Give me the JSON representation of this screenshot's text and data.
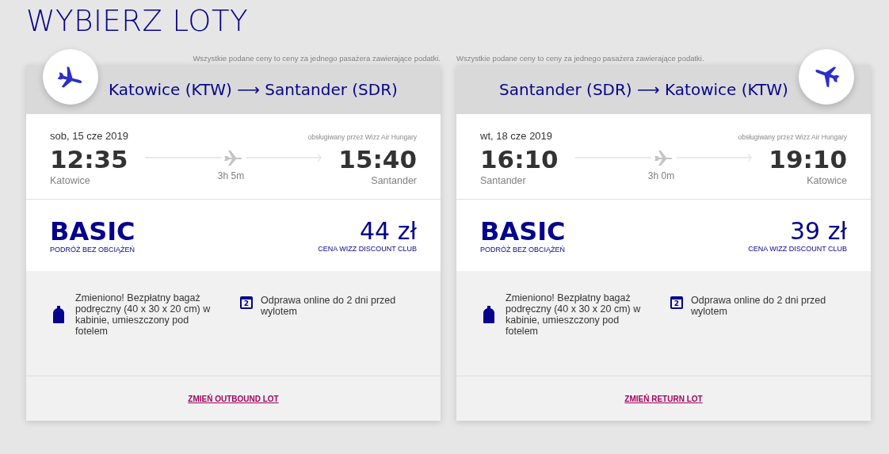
{
  "title": "WYBIERZ LOTY",
  "flights": [
    {
      "kind": "outbound",
      "note": "Wszystkie podane ceny to ceny za jednego pasażera zawierające podatki.",
      "route": "Katowice (KTW) ⟶ Santander (SDR)",
      "date": "sob, 15 cze 2019",
      "operator": "obsługiwany przez Wizz Air Hungary",
      "depart_time": "12:35",
      "depart_city": "Katowice",
      "duration": "3h 5m",
      "arrive_time": "15:40",
      "arrive_city": "Santander",
      "fare": "BASIC",
      "fare_sub": "PODRÓŻ BEZ OBCIĄŻEŃ",
      "price": "44 zł",
      "price_sub": "CENA WIZZ DISCOUNT CLUB",
      "features": [
        {
          "kind": "bag",
          "text": "Zmieniono! Bezpłatny bagaż podręczny (40 x 30 x 20 cm) w kabinie, umieszczony pod fotelem"
        },
        {
          "kind": "calendar",
          "day": "2",
          "text": "Odprawa online do 2 dni przed wylotem"
        }
      ],
      "change_link": "ZMIEŃ OUTBOUND LOT"
    },
    {
      "kind": "return",
      "note": "Wszystkie podane ceny to ceny za jednego pasażera zawierające podatki.",
      "route": "Santander (SDR) ⟶ Katowice (KTW)",
      "date": "wt, 18 cze 2019",
      "operator": "obsługiwany przez Wizz Air Hungary",
      "depart_time": "16:10",
      "depart_city": "Santander",
      "duration": "3h 0m",
      "arrive_time": "19:10",
      "arrive_city": "Katowice",
      "fare": "BASIC",
      "fare_sub": "PODRÓŻ BEZ OBCIĄŻEŃ",
      "price": "39 zł",
      "price_sub": "CENA WIZZ DISCOUNT CLUB",
      "features": [
        {
          "kind": "bag",
          "text": "Zmieniono! Bezpłatny bagaż podręczny (40 x 30 x 20 cm) w kabinie, umieszczony pod fotelem"
        },
        {
          "kind": "calendar",
          "day": "2",
          "text": "Odprawa online do 2 dni przed wylotem"
        }
      ],
      "change_link": "ZMIEŃ RETURN LOT"
    }
  ]
}
